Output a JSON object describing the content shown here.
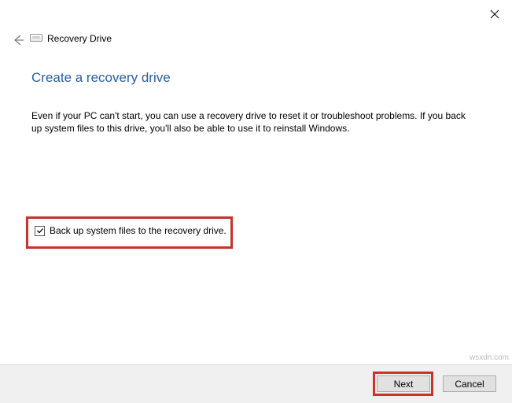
{
  "header": {
    "window_title": "Recovery Drive"
  },
  "page": {
    "heading": "Create a recovery drive",
    "body": "Even if your PC can't start, you can use a recovery drive to reset it or troubleshoot problems. If you back up system files to this drive, you'll also be able to use it to reinstall Windows."
  },
  "checkbox": {
    "label": "Back up system files to the recovery drive.",
    "checked": true
  },
  "buttons": {
    "next": "Next",
    "cancel": "Cancel"
  },
  "watermark": "wsxdn.com"
}
